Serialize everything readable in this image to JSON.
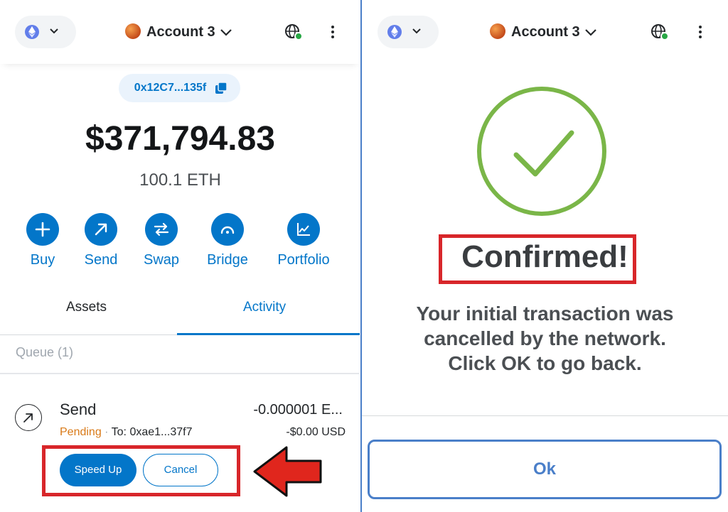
{
  "left": {
    "account": "Account 3",
    "address": "0x12C7...135f",
    "balance_usd": "$371,794.83",
    "balance_eth": "100.1 ETH",
    "actions": [
      "Buy",
      "Send",
      "Swap",
      "Bridge",
      "Portfolio"
    ],
    "tabs": [
      "Assets",
      "Activity"
    ],
    "active_tab": "Activity",
    "queue_label": "Queue (1)",
    "transaction": {
      "title": "Send",
      "amount": "-0.000001 E...",
      "status": "Pending",
      "separator": "·",
      "to": "To: 0xae1...37f7",
      "usd": "-$0.00 USD"
    },
    "buttons": {
      "speed_up": "Speed Up",
      "cancel": "Cancel"
    }
  },
  "right": {
    "account": "Account 3",
    "confirmed": "Confirmed!",
    "message_lines": [
      "Your initial transaction was",
      "cancelled by the network.",
      "Click OK to go back."
    ],
    "ok_label": "Ok"
  },
  "icons": {
    "network": "ethereum-icon",
    "globe": "globe-connected-icon",
    "menu": "kebab-menu-icon",
    "copy": "copy-icon",
    "status": "check-circle-icon",
    "pointer": "red-arrow-icon"
  },
  "colors": {
    "brand_blue": "#0376c9",
    "pending": "#d97a18",
    "highlight_red": "#d8262a",
    "success_green": "#7ab648",
    "ok_border": "#4a7fc9"
  }
}
